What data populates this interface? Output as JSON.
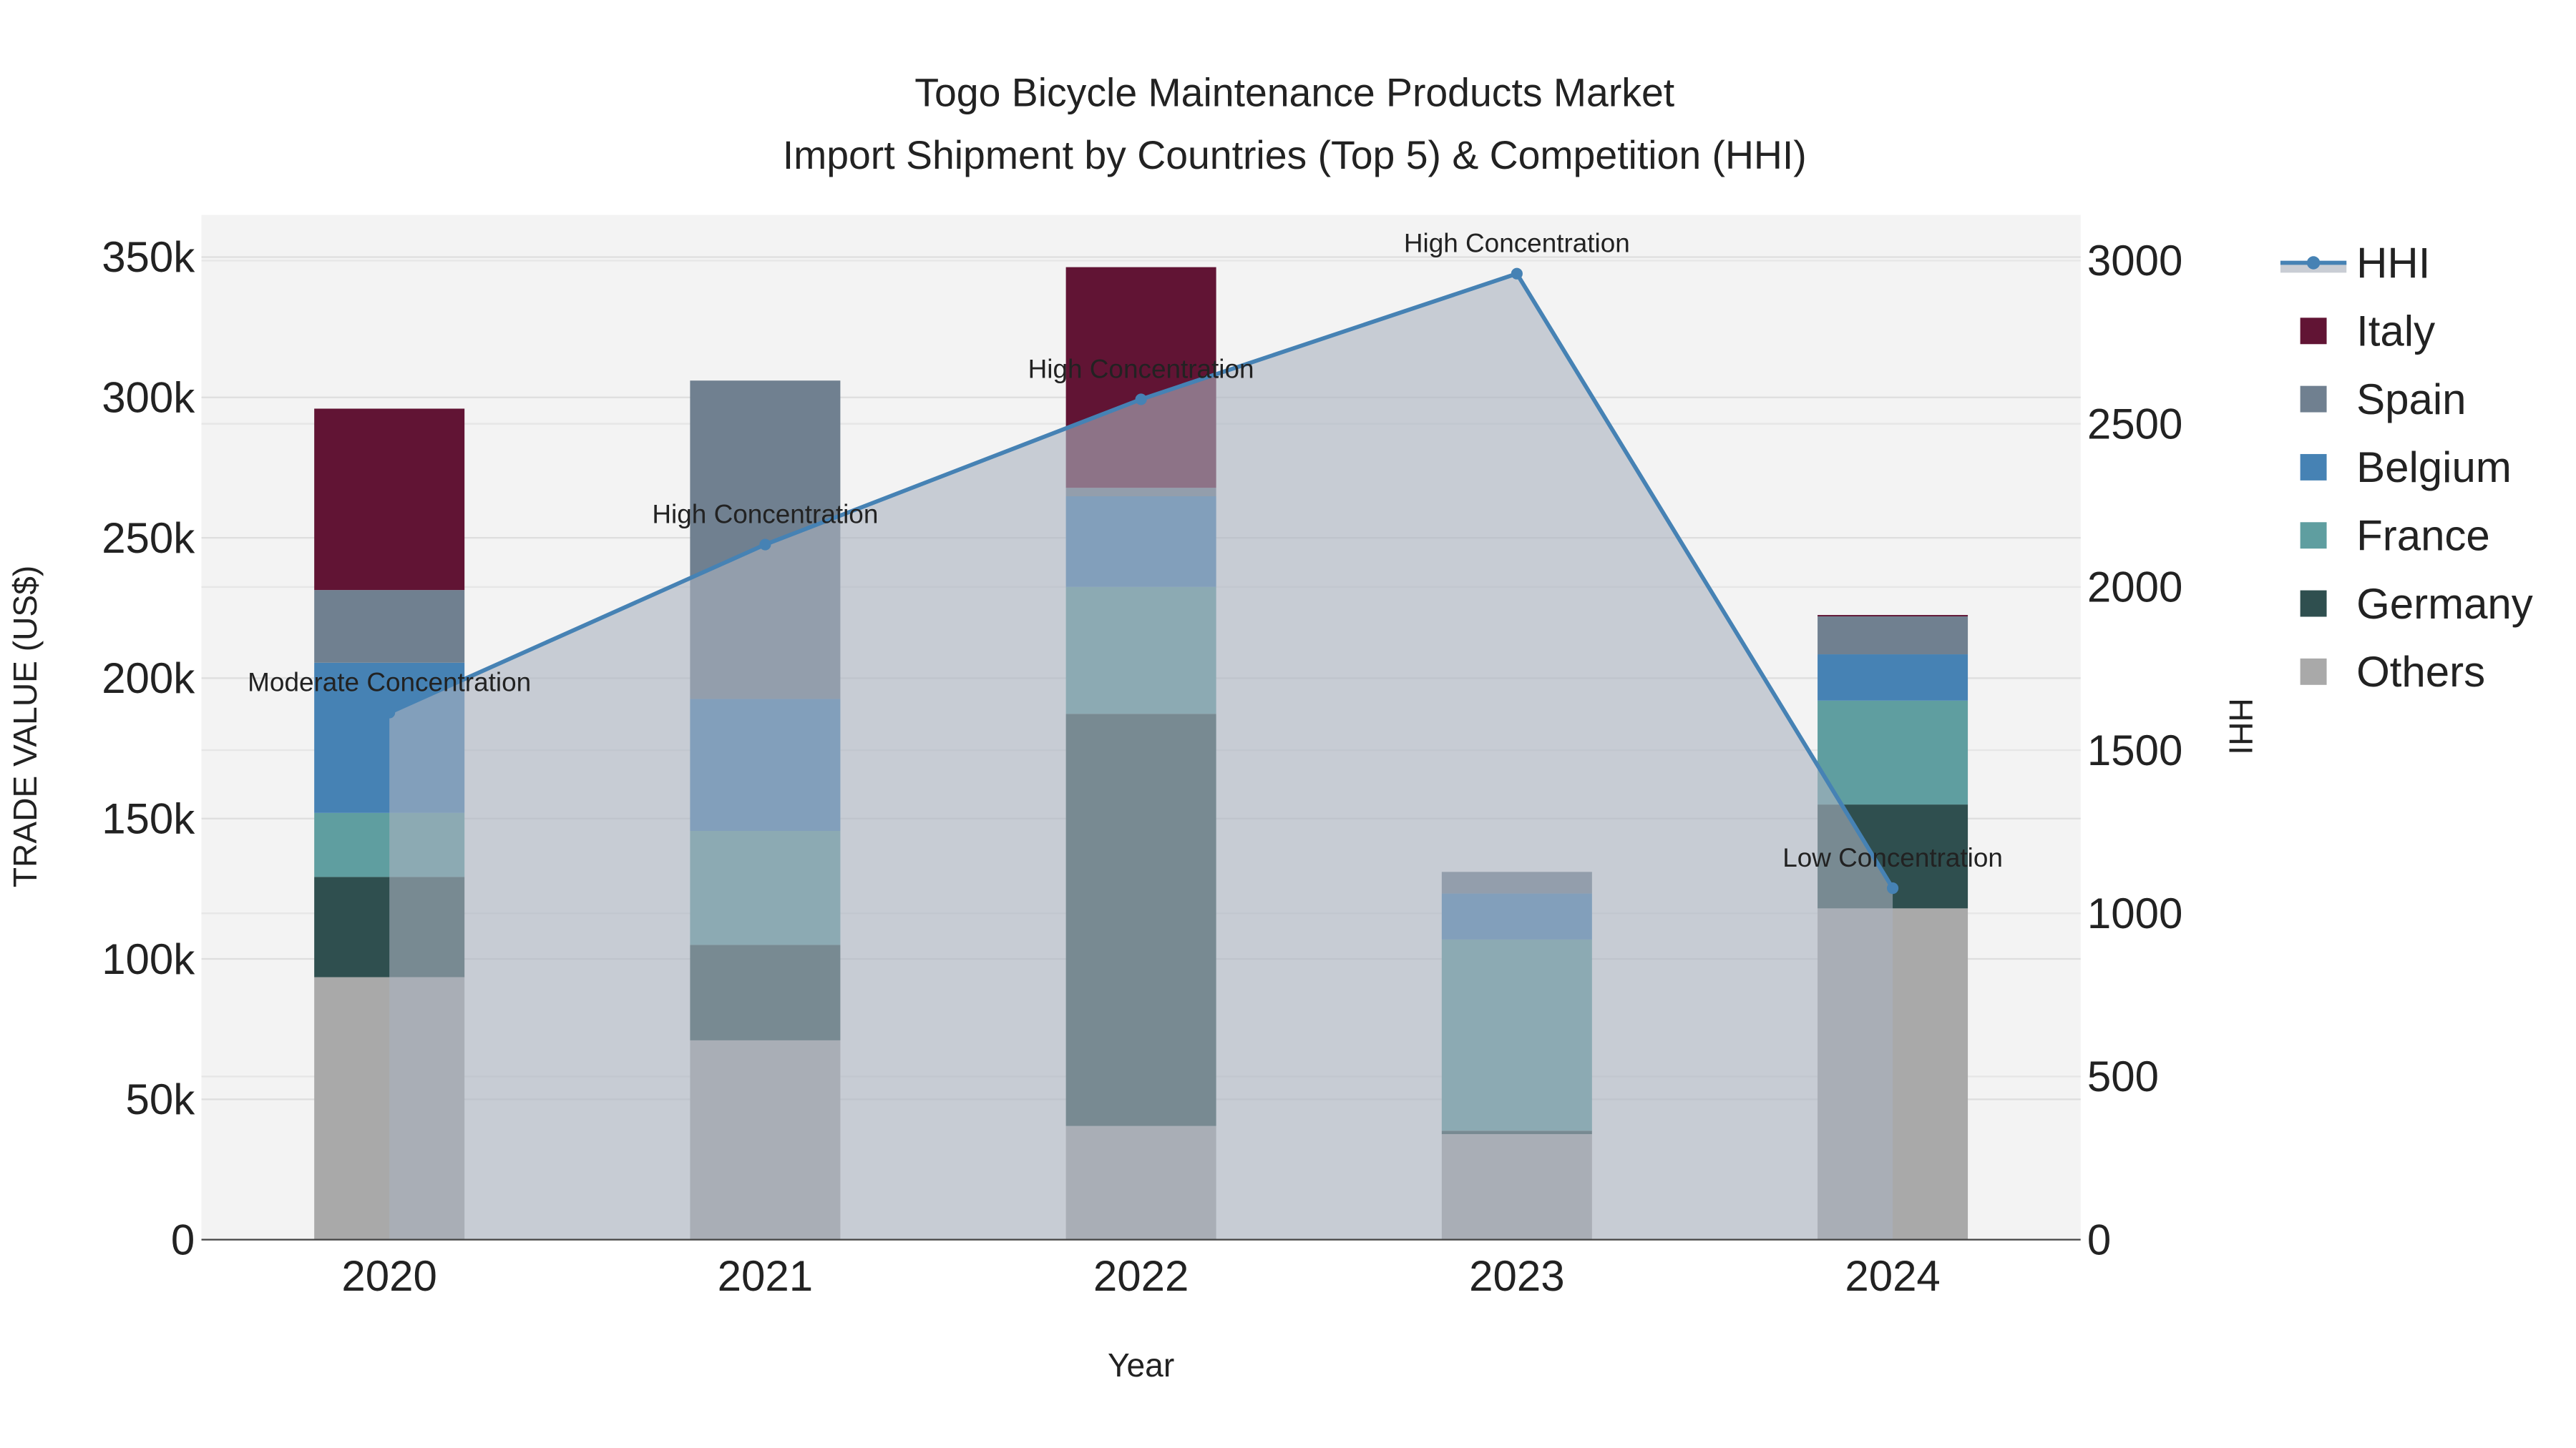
{
  "chart_data": {
    "type": "bar",
    "title": "Togo Bicycle Maintenance Products Market",
    "subtitle": "Import Shipment by Countries (Top 5) & Competition (HHI)",
    "xlabel": "Year",
    "ylabel": "TRADE VALUE (US$)",
    "y2label": "HHI",
    "categories": [
      "2020",
      "2021",
      "2022",
      "2023",
      "2024"
    ],
    "ylim": [
      0,
      365000
    ],
    "y2lim": [
      0,
      3140
    ],
    "yticks": [
      0,
      50000,
      100000,
      150000,
      200000,
      250000,
      300000,
      350000
    ],
    "ytick_labels": [
      "0",
      "50k",
      "100k",
      "150k",
      "200k",
      "250k",
      "300k",
      "350k"
    ],
    "y2ticks": [
      0,
      500,
      1000,
      1500,
      2000,
      2500,
      3000
    ],
    "y2tick_labels": [
      "0",
      "500",
      "1000",
      "1500",
      "2000",
      "2500",
      "3000"
    ],
    "stacked": true,
    "series": [
      {
        "name": "Others",
        "color": "#a9a9a9",
        "values": [
          93500,
          71000,
          40500,
          37600,
          118000
        ]
      },
      {
        "name": "Germany",
        "color": "#2f4f4f",
        "values": [
          35700,
          34000,
          146800,
          1200,
          37000
        ]
      },
      {
        "name": "France",
        "color": "#5f9ea0",
        "values": [
          22800,
          40600,
          45200,
          68100,
          37000
        ]
      },
      {
        "name": "Belgium",
        "color": "#4682b4",
        "values": [
          53500,
          47000,
          32300,
          16400,
          16500
        ]
      },
      {
        "name": "Spain",
        "color": "#708090",
        "values": [
          25900,
          113400,
          3000,
          7700,
          13500
        ]
      },
      {
        "name": "Italy",
        "color": "#611434",
        "values": [
          64600,
          0,
          78600,
          0,
          500
        ]
      }
    ],
    "hhi": {
      "name": "HHI",
      "color": "#4682b4",
      "fill": "rgba(170,178,192,0.6)",
      "values": [
        1615,
        2130,
        2575,
        2960,
        1077
      ],
      "annotations": [
        "Moderate Concentration",
        "High Concentration",
        "High Concentration",
        "High Concentration",
        "Low Concentration"
      ]
    },
    "legend_order": [
      "HHI",
      "Italy",
      "Spain",
      "Belgium",
      "France",
      "Germany",
      "Others"
    ],
    "legend_placement": "right",
    "grid": true
  }
}
